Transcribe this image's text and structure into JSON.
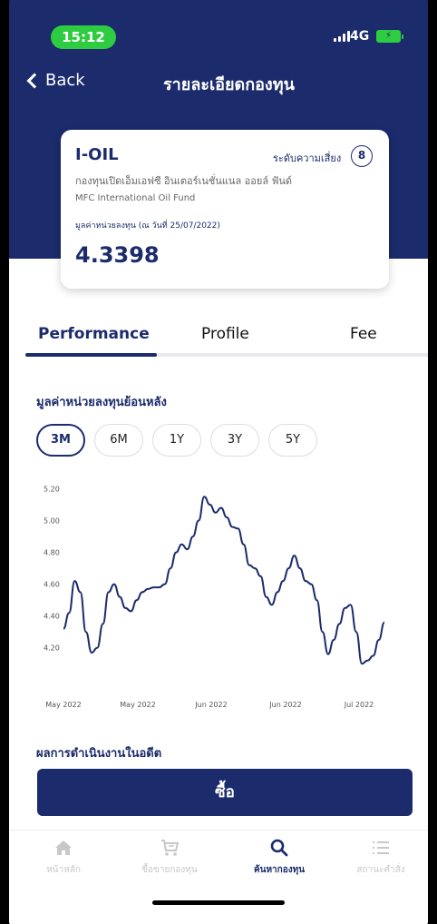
{
  "status": {
    "time": "15:12",
    "network": "4G"
  },
  "header": {
    "back_label": "Back",
    "title": "รายละเอียดกองทุน"
  },
  "fund": {
    "code": "I-OIL",
    "risk_label": "ระดับความเสี่ยง",
    "risk_level": "8",
    "name_th": "กองทุนเปิดเอ็มเอฟซี อินเตอร์เนชั่นแนล ออยล์ ฟันด์",
    "name_en": "MFC International Oil Fund",
    "nav_label": "มูลค่าหน่วยลงทุน (ณ วันที่ 25/07/2022)",
    "nav_value": "4.3398"
  },
  "tabs": [
    {
      "label": "Performance",
      "active": true
    },
    {
      "label": "Profile",
      "active": false
    },
    {
      "label": "Fee",
      "active": false
    }
  ],
  "performance": {
    "section_title": "มูลค่าหน่วยลงทุนย้อนหลัง",
    "periods": [
      "3M",
      "6M",
      "1Y",
      "3Y",
      "5Y"
    ],
    "selected_period": "3M",
    "next_section_title": "ผลการดำเนินงานในอดีต"
  },
  "chart_data": {
    "type": "line",
    "y_ticks": [
      "5.20",
      "5.00",
      "4.80",
      "4.60",
      "4.40",
      "4.20"
    ],
    "ylim": [
      4.05,
      5.22
    ],
    "x_tick_labels": [
      "May 2022",
      "May 2022",
      "Jun 2022",
      "Jun 2022",
      "Jul 2022"
    ],
    "series": [
      {
        "values": [
          4.32,
          4.42,
          4.62,
          4.55,
          4.3,
          4.17,
          4.2,
          4.35,
          4.55,
          4.6,
          4.52,
          4.45,
          4.43,
          4.5,
          4.55,
          4.57,
          4.58,
          4.58,
          4.6,
          4.7,
          4.8,
          4.85,
          4.82,
          4.9,
          5.0,
          5.15,
          5.1,
          5.05,
          5.08,
          5.02,
          4.96,
          4.95,
          4.85,
          4.72,
          4.7,
          4.65,
          4.52,
          4.47,
          4.55,
          4.62,
          4.7,
          4.78,
          4.7,
          4.62,
          4.6,
          4.5,
          4.3,
          4.16,
          4.25,
          4.35,
          4.45,
          4.47,
          4.3,
          4.1,
          4.12,
          4.15,
          4.25,
          4.36
        ]
      }
    ],
    "line_color": "#1b2b6b"
  },
  "actions": {
    "buy_label": "ซื้อ"
  },
  "bottom_nav": [
    {
      "label": "หน้าหลัก",
      "icon": "home-icon",
      "active": false
    },
    {
      "label": "ซื้อขายกองทุน",
      "icon": "cart-icon",
      "active": false
    },
    {
      "label": "ค้นหากองทุน",
      "icon": "search-icon",
      "active": true
    },
    {
      "label": "สถานะคำสั่ง",
      "icon": "list-icon",
      "active": false
    }
  ]
}
